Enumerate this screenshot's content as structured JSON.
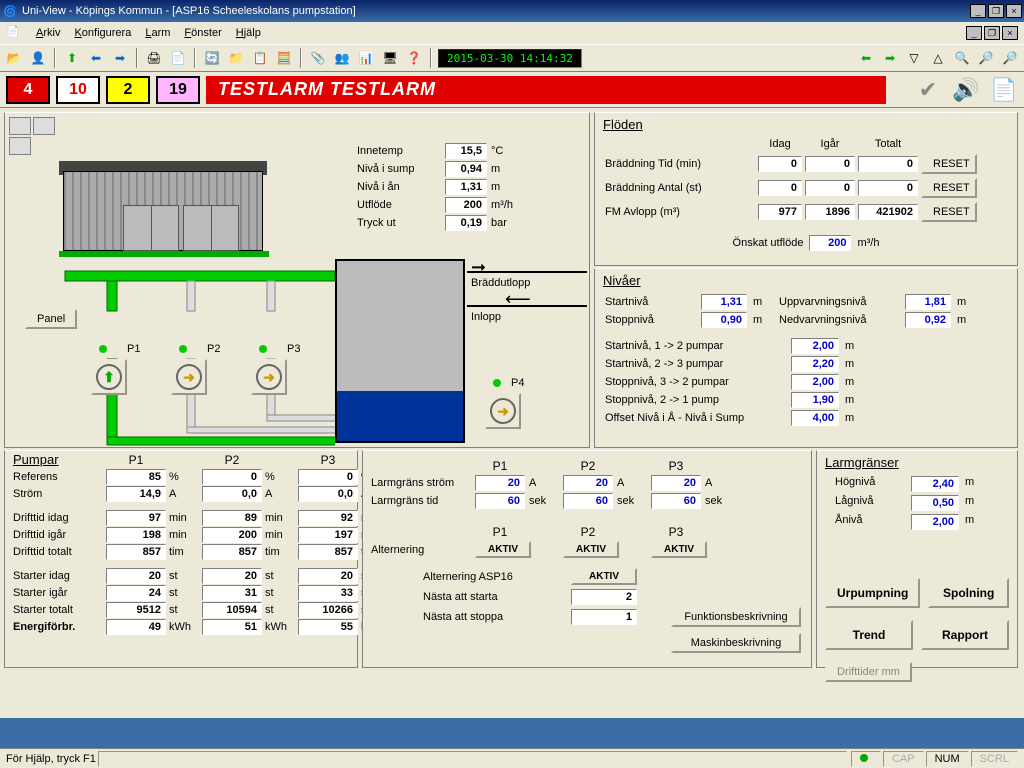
{
  "title": "Uni-View - Köpings Kommun - [ASP16 Scheeleskolans pumpstation]",
  "menu": {
    "arkiv": "Arkiv",
    "konf": "Konfigurera",
    "larm": "Larm",
    "fonster": "Fönster",
    "hjalp": "Hjälp"
  },
  "clock": "2015-03-30 14:14:32",
  "alarms": {
    "a1": "4",
    "a2": "10",
    "a3": "2",
    "a4": "19"
  },
  "banner": "TESTLARM  TESTLARM",
  "sensors": {
    "innetemp_l": "Innetemp",
    "innetemp": "15,5",
    "innetemp_u": "°C",
    "niva_sump_l": "Nivå i sump",
    "niva_sump": "0,94",
    "m": "m",
    "niva_an_l": "Nivå i ån",
    "niva_an": "1,31",
    "utflode_l": "Utflöde",
    "utflode": "200",
    "utflode_u": "m³/h",
    "tryck_l": "Tryck ut",
    "tryck": "0,19",
    "bar": "bar"
  },
  "braddutlopp": "Bräddutlopp",
  "inlopp": "Inlopp",
  "panel_btn": "Panel",
  "pumps": {
    "p1": "P1",
    "p2": "P2",
    "p3": "P3",
    "p4": "P4"
  },
  "floden": {
    "title": "Flöden",
    "idag": "Idag",
    "igar": "Igår",
    "totalt": "Totalt",
    "bradd_tid_l": "Bräddning Tid (min)",
    "bradd_tid": [
      "0",
      "0",
      "0"
    ],
    "bradd_ant_l": "Bräddning Antal (st)",
    "bradd_ant": [
      "0",
      "0",
      "0"
    ],
    "fm_l": "FM Avlopp (m³)",
    "fm": [
      "977",
      "1896",
      "421902"
    ],
    "reset": "RESET",
    "onskat_l": "Önskat utflöde",
    "onskat": "200",
    "onskat_u": "m³/h"
  },
  "nivaer": {
    "title": "Nivåer",
    "start_l": "Startnivå",
    "start": "1,31",
    "stopp_l": "Stoppnivå",
    "stopp": "0,90",
    "upp_l": "Uppvarvningsnivå",
    "upp": "1,81",
    "ned_l": "Nedvarvningsnivå",
    "ned": "0,92",
    "m": "m",
    "s12_l": "Startnivå, 1 -> 2 pumpar",
    "s12": "2,00",
    "s23_l": "Startnivå, 2 -> 3 pumpar",
    "s23": "2,20",
    "st32_l": "Stoppnivå, 3 -> 2 pumpar",
    "st32": "2,00",
    "st21_l": "Stoppnivå, 2 -> 1 pump",
    "st21": "1,90",
    "off_l": "Offset Nivå i Å - Nivå i Sump",
    "off": "4,00"
  },
  "pumpar": {
    "title": "Pumpar",
    "ref_l": "Referens",
    "ref": [
      "85",
      "0",
      "0"
    ],
    "pct": "%",
    "strom_l": "Ström",
    "strom": [
      "14,9",
      "0,0",
      "0,0"
    ],
    "A": "A",
    "didag_l": "Drifttid idag",
    "didag": [
      "97",
      "89",
      "92"
    ],
    "min": "min",
    "digar_l": "Drifttid igår",
    "digar": [
      "198",
      "200",
      "197"
    ],
    "dtot_l": "Drifttid totalt",
    "dtot": [
      "857",
      "857",
      "857"
    ],
    "tim": "tim",
    "sidag_l": "Starter idag",
    "sidag": [
      "20",
      "20",
      "20"
    ],
    "st": "st",
    "sigar_l": "Starter igår",
    "sigar": [
      "24",
      "31",
      "33"
    ],
    "stot_l": "Starter totalt",
    "stot": [
      "9512",
      "10594",
      "10266"
    ],
    "energi_l": "Energiförbr.",
    "energi": [
      "49",
      "51",
      "55"
    ],
    "kwh": "kWh"
  },
  "larm": {
    "lstrom_l": "Larmgräns ström",
    "lstrom": [
      "20",
      "20",
      "20"
    ],
    "A": "A",
    "ltid_l": "Larmgräns tid",
    "ltid": [
      "60",
      "60",
      "60"
    ],
    "sek": "sek",
    "alt_l": "Alternering",
    "aktiv": "AKTIV",
    "altasp_l": "Alternering ASP16",
    "nstart_l": "Nästa att starta",
    "nstart": "2",
    "nstopp_l": "Nästa att stoppa",
    "nstopp": "1",
    "funk": "Funktionsbeskrivning",
    "mask": "Maskinbeskrivning"
  },
  "larmr": {
    "title": "Larmgränser",
    "hog_l": "Högnivå",
    "hog": "2,40",
    "lag_l": "Lågnivå",
    "lag": "0,50",
    "an_l": "Ånivå",
    "an": "2,00",
    "m": "m",
    "urp": "Urpumpning",
    "spol": "Spolning",
    "trend": "Trend",
    "rapport": "Rapport",
    "drift": "Drifttider mm"
  },
  "status": {
    "help": "För Hjälp, tryck F1",
    "cap": "CAP",
    "num": "NUM",
    "scrl": "SCRL"
  }
}
